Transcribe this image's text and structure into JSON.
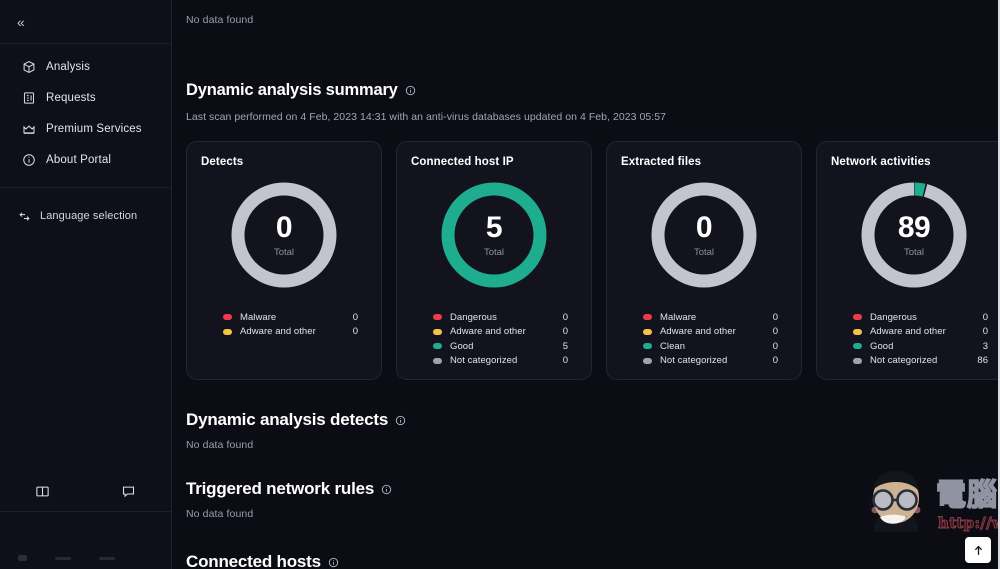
{
  "sidebar": {
    "collapse_label": "«",
    "nav_items": [
      {
        "label": "Analysis",
        "icon": "cube-icon"
      },
      {
        "label": "Requests",
        "icon": "list-document-icon"
      },
      {
        "label": "Premium Services",
        "icon": "crown-icon"
      },
      {
        "label": "About Portal",
        "icon": "info-circle-icon"
      }
    ],
    "language_item": {
      "label": "Language selection",
      "icon": "language-arrows-icon"
    },
    "bottom_icons": [
      {
        "name": "book-icon"
      },
      {
        "name": "chat-bubble-icon"
      }
    ]
  },
  "main": {
    "top_no_data": "No data found",
    "summary": {
      "title": "Dynamic analysis summary",
      "info_icon": "info-circle-icon",
      "subtitle": "Last scan performed on 4 Feb, 2023 14:31 with an anti-virus databases updated on 4 Feb, 2023 05:57"
    },
    "cards": [
      {
        "title": "Detects",
        "total": "0",
        "total_label": "Total",
        "ring_color": "#c2c5cd",
        "segments": [
          {
            "color": "#c2c5cd",
            "value": 1
          }
        ],
        "legend": [
          {
            "label": "Malware",
            "value": "0",
            "color": "#ef3a4c"
          },
          {
            "label": "Adware and other",
            "value": "0",
            "color": "#f5c243"
          }
        ]
      },
      {
        "title": "Connected host IP",
        "total": "5",
        "total_label": "Total",
        "ring_color": "#1fad8f",
        "segments": [
          {
            "color": "#1fad8f",
            "value": 1
          }
        ],
        "legend": [
          {
            "label": "Dangerous",
            "value": "0",
            "color": "#ef3a4c"
          },
          {
            "label": "Adware and other",
            "value": "0",
            "color": "#f5c243"
          },
          {
            "label": "Good",
            "value": "5",
            "color": "#1fad8f"
          },
          {
            "label": "Not categorized",
            "value": "0",
            "color": "#9fa3ae"
          }
        ]
      },
      {
        "title": "Extracted files",
        "total": "0",
        "total_label": "Total",
        "ring_color": "#c2c5cd",
        "segments": [
          {
            "color": "#c2c5cd",
            "value": 1
          }
        ],
        "legend": [
          {
            "label": "Malware",
            "value": "0",
            "color": "#ef3a4c"
          },
          {
            "label": "Adware and other",
            "value": "0",
            "color": "#f5c243"
          },
          {
            "label": "Clean",
            "value": "0",
            "color": "#1fad8f"
          },
          {
            "label": "Not categorized",
            "value": "0",
            "color": "#9fa3ae"
          }
        ]
      },
      {
        "title": "Network activities",
        "total": "89",
        "total_label": "Total",
        "ring_color": "#c2c5cd",
        "segments": [
          {
            "color": "#1fad8f",
            "value": 3
          },
          {
            "color": "#c2c5cd",
            "value": 86
          }
        ],
        "legend": [
          {
            "label": "Dangerous",
            "value": "0",
            "color": "#ef3a4c"
          },
          {
            "label": "Adware and other",
            "value": "0",
            "color": "#f5c243"
          },
          {
            "label": "Good",
            "value": "3",
            "color": "#1fad8f"
          },
          {
            "label": "Not categorized",
            "value": "86",
            "color": "#9fa3ae"
          }
        ]
      }
    ],
    "detects_block": {
      "title": "Dynamic analysis detects",
      "no_data": "No data found"
    },
    "rules_block": {
      "title": "Triggered network rules",
      "no_data": "No data found"
    },
    "hosts_block": {
      "title": "Connected hosts"
    }
  },
  "watermark": {
    "text": "電腦王阿達",
    "url": "http://www.kocpc.com.tw"
  },
  "scroll_top": {
    "icon": "arrow-up-icon"
  },
  "chart_data": [
    {
      "type": "pie",
      "title": "Detects",
      "categories": [
        "Malware",
        "Adware and other"
      ],
      "values": [
        0,
        0
      ],
      "total": 0
    },
    {
      "type": "pie",
      "title": "Connected host IP",
      "categories": [
        "Dangerous",
        "Adware and other",
        "Good",
        "Not categorized"
      ],
      "values": [
        0,
        0,
        5,
        0
      ],
      "total": 5
    },
    {
      "type": "pie",
      "title": "Extracted files",
      "categories": [
        "Malware",
        "Adware and other",
        "Clean",
        "Not categorized"
      ],
      "values": [
        0,
        0,
        0,
        0
      ],
      "total": 0
    },
    {
      "type": "pie",
      "title": "Network activities",
      "categories": [
        "Dangerous",
        "Adware and other",
        "Good",
        "Not categorized"
      ],
      "values": [
        0,
        0,
        3,
        86
      ],
      "total": 89
    }
  ]
}
